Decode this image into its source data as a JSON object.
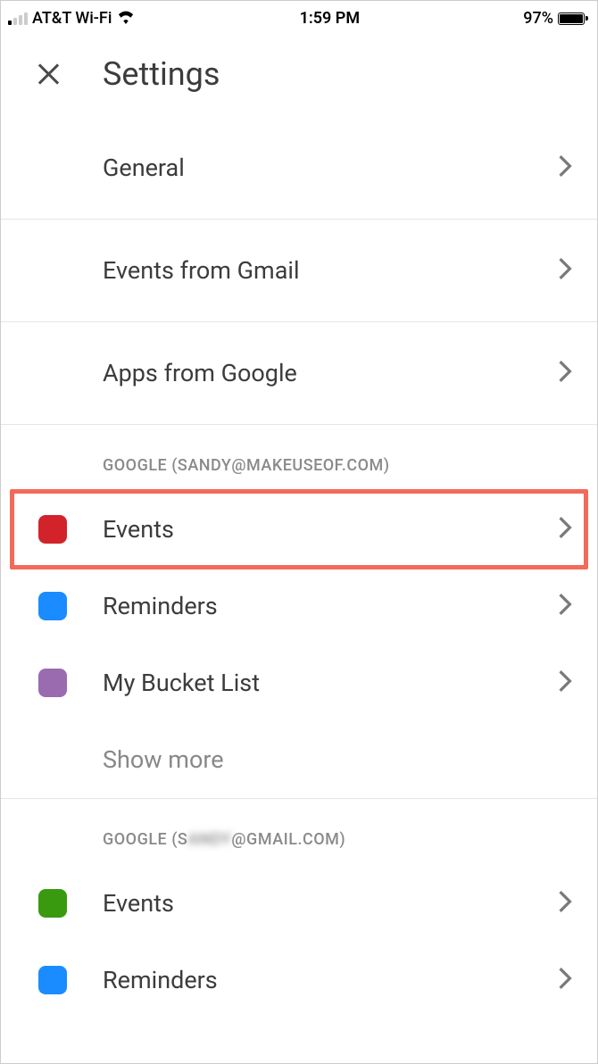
{
  "statusbar": {
    "carrier": "AT&T Wi-Fi",
    "time": "1:59 PM",
    "battery_pct": "97%"
  },
  "header": {
    "title": "Settings"
  },
  "top_items": [
    {
      "label": "General"
    },
    {
      "label": "Events from Gmail"
    },
    {
      "label": "Apps from Google"
    }
  ],
  "accounts": [
    {
      "header": "GOOGLE (SANDY@MAKEUSEOF.COM)",
      "items": [
        {
          "label": "Events",
          "color": "#d2232a",
          "highlighted": true
        },
        {
          "label": "Reminders",
          "color": "#1a8cff"
        },
        {
          "label": "My Bucket List",
          "color": "#9b6bb0"
        }
      ],
      "show_more": "Show more"
    },
    {
      "header_prefix": "GOOGLE (S",
      "header_blur": "ANDY",
      "header_suffix": "@GMAIL.COM)",
      "items": [
        {
          "label": "Events",
          "color": "#3a9a0f"
        },
        {
          "label": "Reminders",
          "color": "#1a8cff"
        }
      ]
    }
  ]
}
